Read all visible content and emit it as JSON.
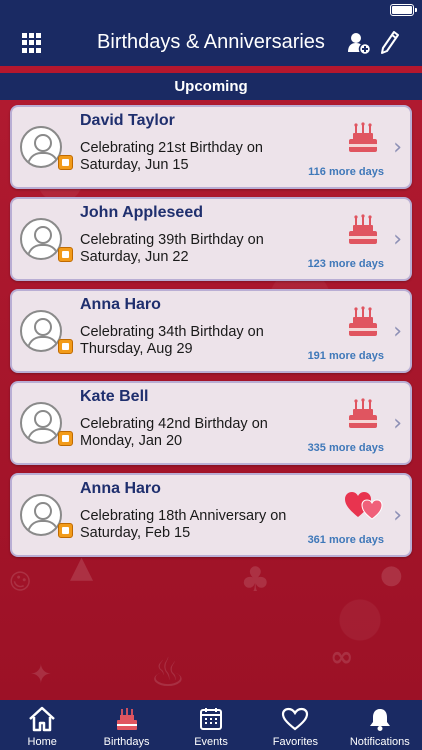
{
  "header": {
    "title": "Birthdays & Anniversaries"
  },
  "section": {
    "title": "Upcoming"
  },
  "events": [
    {
      "name": "David Taylor",
      "line1": "Celebrating 21st Birthday on",
      "line2": "Saturday, Jun 15",
      "days": "116 more days",
      "type": "birthday"
    },
    {
      "name": "John Appleseed",
      "line1": "Celebrating 39th Birthday on",
      "line2": "Saturday, Jun 22",
      "days": "123 more days",
      "type": "birthday"
    },
    {
      "name": "Anna Haro",
      "line1": "Celebrating 34th Birthday on",
      "line2": "Thursday, Aug 29",
      "days": "191 more days",
      "type": "birthday"
    },
    {
      "name": "Kate Bell",
      "line1": "Celebrating 42nd Birthday on",
      "line2": "Monday, Jan 20",
      "days": "335 more days",
      "type": "birthday"
    },
    {
      "name": "Anna Haro",
      "line1": "Celebrating 18th Anniversary on",
      "line2": "Saturday, Feb 15",
      "days": "361 more days",
      "type": "anniversary"
    }
  ],
  "tabs": [
    {
      "label": "Home",
      "icon": "home-icon"
    },
    {
      "label": "Birthdays",
      "icon": "cake-icon"
    },
    {
      "label": "Events",
      "icon": "calendar-icon"
    },
    {
      "label": "Favorites",
      "icon": "heart-icon"
    },
    {
      "label": "Notifications",
      "icon": "bell-icon"
    }
  ],
  "colors": {
    "navy": "#1a2a63",
    "red": "#a8152a",
    "card": "#ede3ea",
    "name": "#1f2f6e",
    "days": "#3f78b9"
  }
}
